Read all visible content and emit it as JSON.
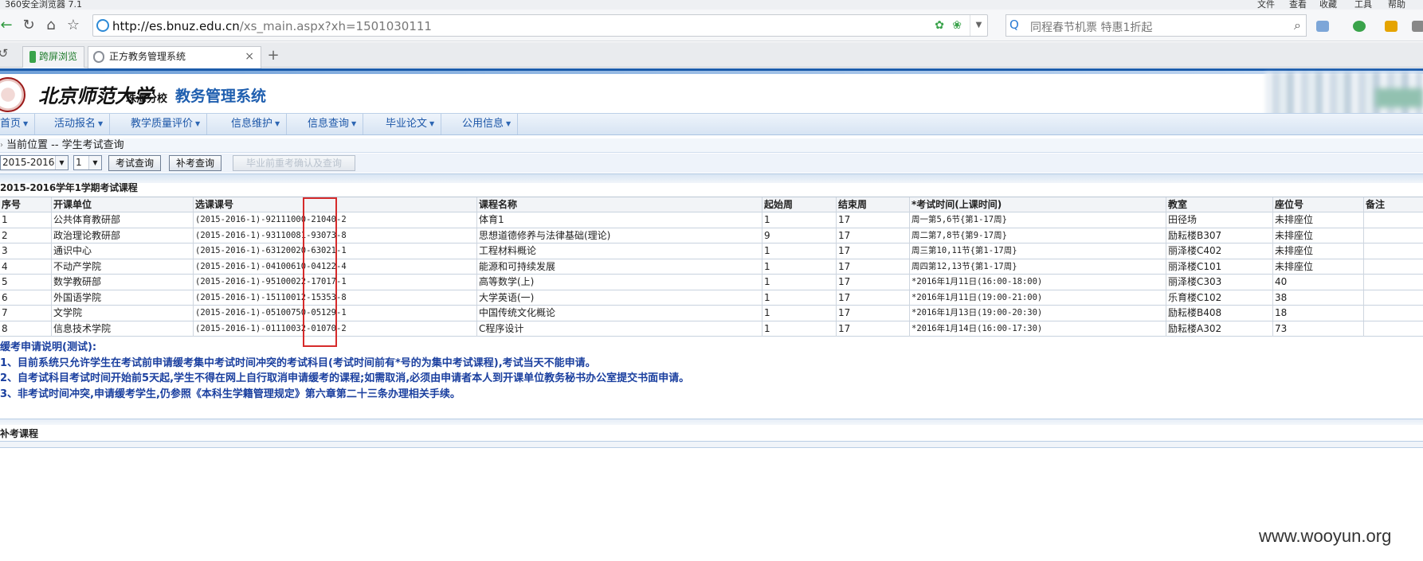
{
  "browser": {
    "title": "360安全浏览器 7.1",
    "window_menu": [
      "文件",
      "查看",
      "收藏",
      "工具",
      "帮助"
    ],
    "url_host": "http://es.bnuz.edu.cn",
    "url_path": "/xs_main.aspx?xh=1501030111",
    "search_text": "同程春节机票  特惠1折起",
    "tabs": [
      {
        "label": "跨屏浏览",
        "color": "#3aa34b"
      },
      {
        "label": "正方教务管理系统",
        "color": "#8a8f98",
        "close": "×"
      }
    ],
    "add_tab": "+"
  },
  "header": {
    "university": "北京师范大学",
    "campus": "珠海分校",
    "system_title": "教务管理系统"
  },
  "menu": [
    {
      "label": "首页"
    },
    {
      "label": "活动报名"
    },
    {
      "label": "教学质量评价"
    },
    {
      "label": "信息维护"
    },
    {
      "label": "信息查询"
    },
    {
      "label": "毕业论文"
    },
    {
      "label": "公用信息"
    }
  ],
  "location": "当前位置 -- 学生考试查询",
  "controls": {
    "year": "2015-2016",
    "term": "1",
    "exam_query_button": "考试查询",
    "makeup_query_button": "补考查询",
    "graduation_button": "毕业前重考确认及查询"
  },
  "section_title": "2015-2016学年1学期考试课程",
  "table": {
    "headers": [
      "序号",
      "开课单位",
      "选课课号",
      "课程名称",
      "起始周",
      "结束周",
      "*考试时间(上课时间)",
      "教室",
      "座位号",
      "备注"
    ],
    "rows": [
      [
        "1",
        "公共体育教研部",
        "(2015-2016-1)-92111000-21040-2",
        "体育1",
        "1",
        "17",
        "周一第5,6节{第1-17周}",
        "田径场",
        "未排座位",
        ""
      ],
      [
        "2",
        "政治理论教研部",
        "(2015-2016-1)-93110081-93073-8",
        "思想道德修养与法律基础(理论)",
        "9",
        "17",
        "周二第7,8节{第9-17周}",
        "励耘楼B307",
        "未排座位",
        ""
      ],
      [
        "3",
        "通识中心",
        "(2015-2016-1)-63120020-63021-1",
        "工程材料概论",
        "1",
        "17",
        "周三第10,11节{第1-17周}",
        "丽泽楼C402",
        "未排座位",
        ""
      ],
      [
        "4",
        "不动产学院",
        "(2015-2016-1)-04100610-04122-4",
        "能源和可持续发展",
        "1",
        "17",
        "周四第12,13节{第1-17周}",
        "丽泽楼C101",
        "未排座位",
        ""
      ],
      [
        "5",
        "数学教研部",
        "(2015-2016-1)-95100022-17017-1",
        "高等数学(上)",
        "1",
        "17",
        "*2016年1月11日(16:00-18:00)",
        "丽泽楼C303",
        "40",
        ""
      ],
      [
        "6",
        "外国语学院",
        "(2015-2016-1)-15110012-15353-8",
        "大学英语(一)",
        "1",
        "17",
        "*2016年1月11日(19:00-21:00)",
        "乐育楼C102",
        "38",
        ""
      ],
      [
        "7",
        "文学院",
        "(2015-2016-1)-05100750-05129-1",
        "中国传统文化概论",
        "1",
        "17",
        "*2016年1月13日(19:00-20:30)",
        "励耘楼B408",
        "18",
        ""
      ],
      [
        "8",
        "信息技术学院",
        "(2015-2016-1)-01110032-01070-2",
        "C程序设计",
        "1",
        "17",
        "*2016年1月14日(16:00-17:30)",
        "励耘楼A302",
        "73",
        ""
      ]
    ]
  },
  "notes": [
    "缓考申请说明(测试):",
    "1、目前系统只允许学生在考试前申请缓考集中考试时间冲突的考试科目(考试时间前有*号的为集中考试课程),考试当天不能申请。",
    "2、自考试科目考试时间开始前5天起,学生不得在网上自行取消申请缓考的课程;如需取消,必须由申请者本人到开课单位教务秘书办公室提交书面申请。",
    "3、非考试时间冲突,申请缓考学生,仍参照《本科生学籍管理规定》第六章第二十三条办理相关手续。"
  ],
  "makeup_title": "补考课程",
  "watermark": "www.wooyun.org",
  "colors": {
    "accent": "#1e5eaf",
    "highlight": "#d62b2b",
    "notes_text": "#1a3f9f"
  }
}
